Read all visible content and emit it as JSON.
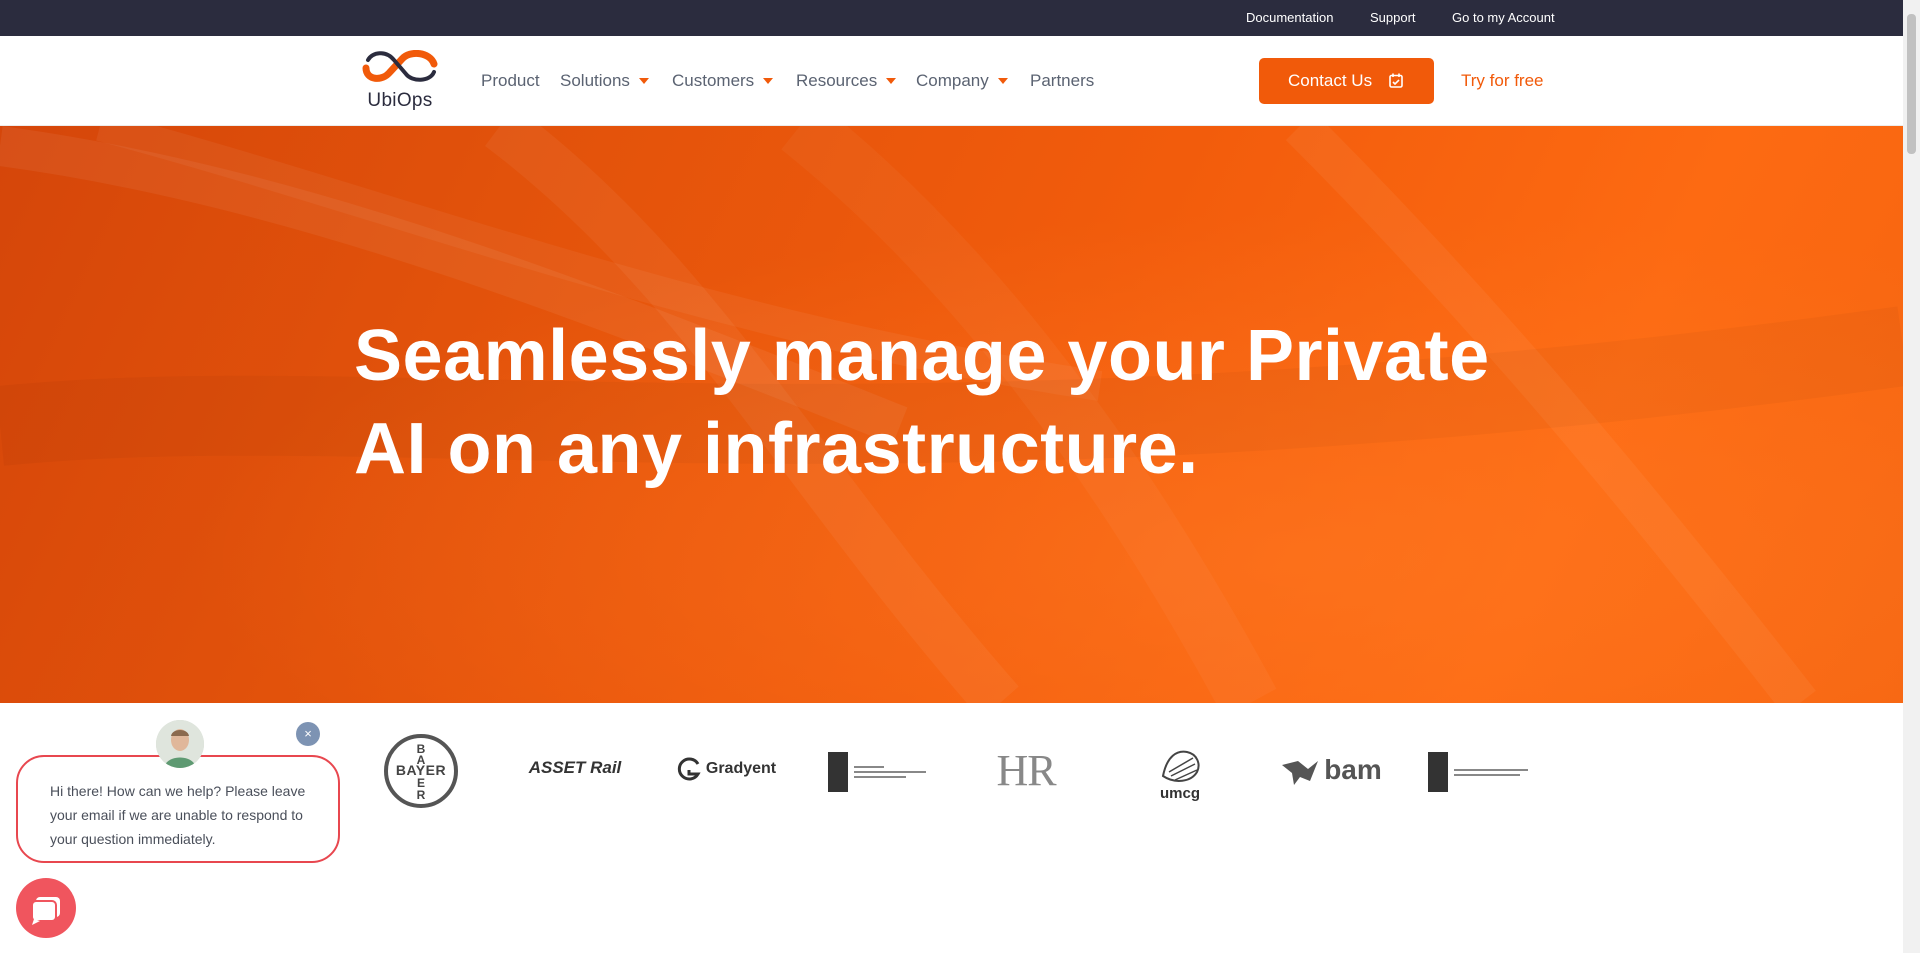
{
  "topbar": {
    "links": [
      "Documentation",
      "Support",
      "Go to my Account"
    ]
  },
  "nav": {
    "logo_text": "UbiOps",
    "items": [
      {
        "label": "Product"
      },
      {
        "label": "Solutions"
      },
      {
        "label": "Customers"
      },
      {
        "label": "Resources"
      },
      {
        "label": "Company"
      },
      {
        "label": "Partners"
      }
    ],
    "contact_label": "Contact Us",
    "try_label": "Try for free"
  },
  "hero": {
    "line1": "Seamlessly manage your Private",
    "line2": "AI on any infrastructure."
  },
  "customer_logos": {
    "bayer": "BAYER",
    "asset_rail": "ASSET Rail",
    "gradyent": "Gradyent",
    "hr": "HR",
    "umcg": "umcg",
    "bam": "bam"
  },
  "chat": {
    "message": "Hi there! How can we help? Please leave your email if we are unable to respond to your question immediately.",
    "close": "×"
  },
  "colors": {
    "brand_orange": "#f15a0a",
    "topbar": "#2b2c3e",
    "chat_accent": "#e8474f"
  },
  "icons": [
    "calendar-icon",
    "close-icon",
    "chat-icon",
    "logo-mark"
  ]
}
